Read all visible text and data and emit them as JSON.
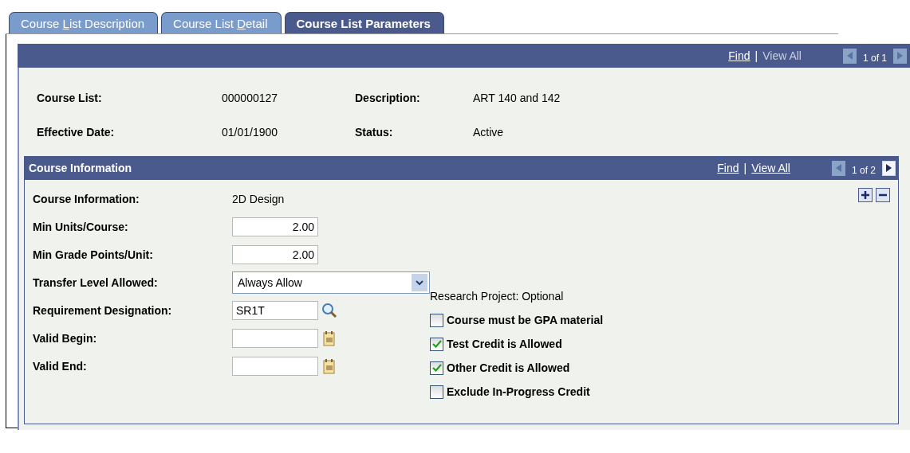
{
  "tabs": [
    {
      "label": {
        "before": "Course ",
        "key": "L",
        "after": "ist Description"
      },
      "selected": false
    },
    {
      "label": {
        "before": "Course List ",
        "key": "D",
        "after": "etail"
      },
      "selected": false
    },
    {
      "label": {
        "before": "Course List Parameters"
      },
      "selected": true
    }
  ],
  "main_panel": {
    "find": "Find",
    "separator": "|",
    "view_all": {
      "label": "View All",
      "disabled": true
    },
    "prev": {
      "disabled": true
    },
    "counter": "1 of 1",
    "next": {
      "disabled": true
    },
    "fields": [
      {
        "label": "Course List:",
        "value": "000000127"
      },
      {
        "label": "Description:",
        "value": "ART 140 and 142"
      },
      {
        "label": "Effective Date:",
        "value": "01/01/1900"
      },
      {
        "label": "Status:",
        "value": "Active"
      }
    ]
  },
  "course_panel": {
    "title": "Course Information",
    "find": "Find",
    "separator": "|",
    "view_all": {
      "label": "View All",
      "disabled": false
    },
    "prev": {
      "disabled": true
    },
    "counter": "1 of 2",
    "next": {
      "disabled": false
    },
    "rows": [
      {
        "kind": "text",
        "label": "Course Information:",
        "value": "2D Design"
      },
      {
        "kind": "number",
        "label": "Min Units/Course:",
        "value": "2.00"
      },
      {
        "kind": "number",
        "label": "Min Grade Points/Unit:",
        "value": "2.00"
      },
      {
        "kind": "select",
        "label": "Transfer Level Allowed:",
        "value": "Always Allow"
      },
      {
        "kind": "lookup",
        "label": "Requirement Designation:",
        "value": "SR1T"
      },
      {
        "kind": "date",
        "label": "Valid Begin:"
      },
      {
        "kind": "date",
        "label": "Valid End:"
      }
    ],
    "research_project": "Research Project: Optional",
    "checkboxes": [
      {
        "label": "Course must be GPA material",
        "checked": false
      },
      {
        "label": "Test Credit is Allowed",
        "checked": true
      },
      {
        "label": "Other Credit is Allowed",
        "checked": true
      },
      {
        "label": "Exclude In-Progress Credit",
        "checked": false
      }
    ]
  }
}
